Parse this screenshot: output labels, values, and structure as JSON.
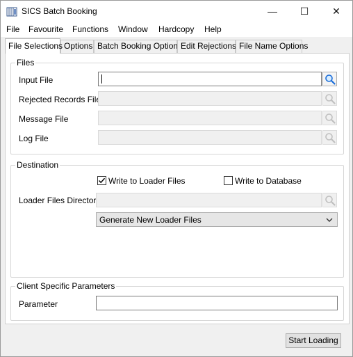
{
  "window": {
    "title": "SICS Batch Booking",
    "controls": {
      "minimize": "—",
      "maximize": "☐",
      "close": "✕"
    }
  },
  "menu": [
    "File",
    "Favourite",
    "Functions",
    "Window",
    "Hardcopy",
    "Help"
  ],
  "tabs": [
    {
      "label": "File Selections",
      "active": true
    },
    {
      "label": "Options"
    },
    {
      "label": "Batch Booking Options"
    },
    {
      "label": "Edit Rejections"
    },
    {
      "label": "File Name Options"
    }
  ],
  "files_group": {
    "title": "Files",
    "fields": [
      {
        "label": "Input File",
        "value": "",
        "enabled": true
      },
      {
        "label": "Rejected Records File",
        "value": "",
        "enabled": false
      },
      {
        "label": "Message File",
        "value": "",
        "enabled": false
      },
      {
        "label": "Log File",
        "value": "",
        "enabled": false
      }
    ]
  },
  "destination_group": {
    "title": "Destination",
    "write_loader": {
      "label": "Write to Loader Files",
      "checked": true
    },
    "write_db": {
      "label": "Write to Database",
      "checked": false
    },
    "loader_dir_label": "Loader Files Directory",
    "loader_dir_value": "",
    "combo_value": "Generate New Loader Files"
  },
  "client_group": {
    "title": "Client Specific Parameters",
    "parameter_label": "Parameter",
    "parameter_value": ""
  },
  "footer": {
    "start_label": "Start Loading"
  },
  "icons": {
    "browse": "magnifier-icon",
    "check": "checkmark-icon",
    "app": "app-icon"
  },
  "colors": {
    "accent": "#1e6fd9",
    "disabled": "#b8b8b8"
  }
}
